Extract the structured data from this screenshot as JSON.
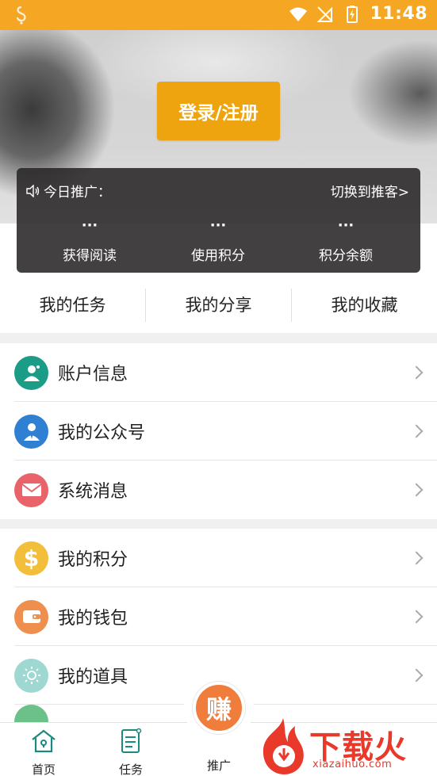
{
  "status_bar": {
    "time": "11:48"
  },
  "header": {
    "login_button": "登录/注册"
  },
  "promo": {
    "title": "今日推广：",
    "switch_link": "切换到推客>",
    "stats": [
      {
        "value": "···",
        "label": "获得阅读"
      },
      {
        "value": "···",
        "label": "使用积分"
      },
      {
        "value": "···",
        "label": "积分余额"
      }
    ]
  },
  "tabs": [
    "我的任务",
    "我的分享",
    "我的收藏"
  ],
  "group1": [
    {
      "label": "账户信息",
      "icon": "user-icon",
      "color": "#1a9c86"
    },
    {
      "label": "我的公众号",
      "icon": "officer-icon",
      "color": "#2f7fd3"
    },
    {
      "label": "系统消息",
      "icon": "mail-icon",
      "color": "#e8646a"
    }
  ],
  "group2": [
    {
      "label": "我的积分",
      "icon": "dollar-icon",
      "color": "#f3bf3a"
    },
    {
      "label": "我的钱包",
      "icon": "wallet-icon",
      "color": "#ef8f4f"
    },
    {
      "label": "我的道具",
      "icon": "sun-icon",
      "color": "#9fd8d2"
    }
  ],
  "bottom_nav": {
    "home": "首页",
    "tasks": "任务",
    "earn_glyph": "赚",
    "promote": "推广"
  },
  "watermark": {
    "title": "下载火",
    "url": "xiazaihuo.com"
  }
}
